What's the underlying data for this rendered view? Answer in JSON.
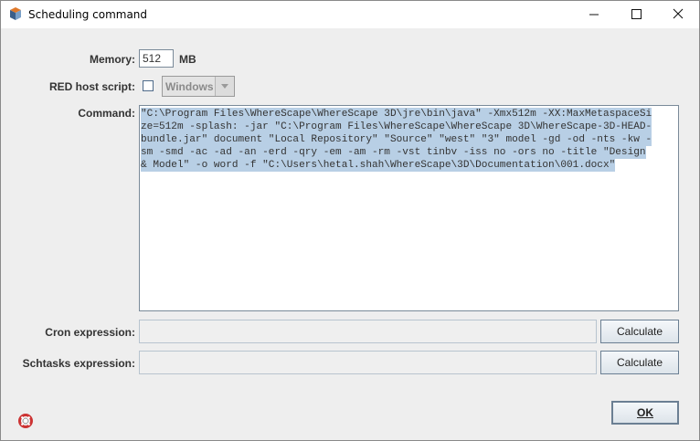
{
  "window": {
    "title": "Scheduling command"
  },
  "form": {
    "memory": {
      "label": "Memory:",
      "value": "512",
      "unit": "MB"
    },
    "red_host_script": {
      "label": "RED host script:",
      "checked": false,
      "dropdown_value": "Windows"
    },
    "command": {
      "label": "Command:",
      "lines": [
        "\"C:\\Program Files\\WhereScape\\WhereScape 3D\\jre\\bin\\java\" -Xmx512m -XX:MaxMetaspaceSi",
        "ze=512m -splash: -jar \"C:\\Program Files\\WhereScape\\WhereScape 3D\\WhereScape-3D-HEAD-",
        "bundle.jar\" document \"Local Repository\" \"Source\" \"west\" \"3\" model -gd -od -nts -kw -",
        "sm -smd -ac -ad -an -erd -qry -em -am -rm -vst tinbv -iss no -ors no -title \"Design",
        "& Model\" -o word -f \"C:\\Users\\hetal.shah\\WhereScape\\3D\\Documentation\\001.docx\""
      ]
    },
    "cron": {
      "label": "Cron expression:",
      "value": "",
      "button": "Calculate"
    },
    "schtasks": {
      "label": "Schtasks expression:",
      "value": "",
      "button": "Calculate"
    }
  },
  "footer": {
    "ok": "OK"
  },
  "icons": [
    "app-icon",
    "minimize-icon",
    "maximize-icon",
    "close-icon",
    "help-icon"
  ],
  "colors": {
    "selection": "#b8cfe5",
    "window_bg": "#eeeeee"
  }
}
